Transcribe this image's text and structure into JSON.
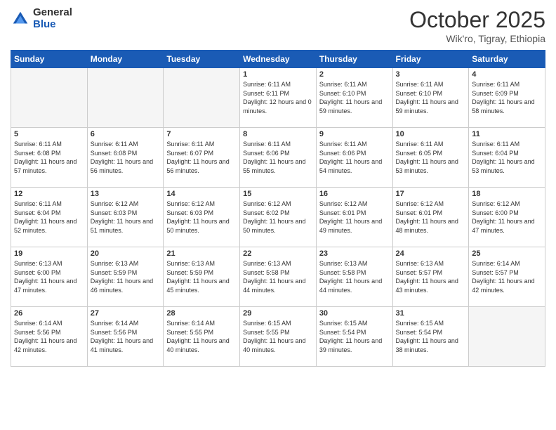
{
  "logo": {
    "general": "General",
    "blue": "Blue"
  },
  "header": {
    "title": "October 2025",
    "subtitle": "Wik'ro, Tigray, Ethiopia"
  },
  "weekdays": [
    "Sunday",
    "Monday",
    "Tuesday",
    "Wednesday",
    "Thursday",
    "Friday",
    "Saturday"
  ],
  "weeks": [
    [
      {
        "day": "",
        "info": ""
      },
      {
        "day": "",
        "info": ""
      },
      {
        "day": "",
        "info": ""
      },
      {
        "day": "1",
        "info": "Sunrise: 6:11 AM\nSunset: 6:11 PM\nDaylight: 12 hours\nand 0 minutes."
      },
      {
        "day": "2",
        "info": "Sunrise: 6:11 AM\nSunset: 6:10 PM\nDaylight: 11 hours\nand 59 minutes."
      },
      {
        "day": "3",
        "info": "Sunrise: 6:11 AM\nSunset: 6:10 PM\nDaylight: 11 hours\nand 59 minutes."
      },
      {
        "day": "4",
        "info": "Sunrise: 6:11 AM\nSunset: 6:09 PM\nDaylight: 11 hours\nand 58 minutes."
      }
    ],
    [
      {
        "day": "5",
        "info": "Sunrise: 6:11 AM\nSunset: 6:08 PM\nDaylight: 11 hours\nand 57 minutes."
      },
      {
        "day": "6",
        "info": "Sunrise: 6:11 AM\nSunset: 6:08 PM\nDaylight: 11 hours\nand 56 minutes."
      },
      {
        "day": "7",
        "info": "Sunrise: 6:11 AM\nSunset: 6:07 PM\nDaylight: 11 hours\nand 56 minutes."
      },
      {
        "day": "8",
        "info": "Sunrise: 6:11 AM\nSunset: 6:06 PM\nDaylight: 11 hours\nand 55 minutes."
      },
      {
        "day": "9",
        "info": "Sunrise: 6:11 AM\nSunset: 6:06 PM\nDaylight: 11 hours\nand 54 minutes."
      },
      {
        "day": "10",
        "info": "Sunrise: 6:11 AM\nSunset: 6:05 PM\nDaylight: 11 hours\nand 53 minutes."
      },
      {
        "day": "11",
        "info": "Sunrise: 6:11 AM\nSunset: 6:04 PM\nDaylight: 11 hours\nand 53 minutes."
      }
    ],
    [
      {
        "day": "12",
        "info": "Sunrise: 6:11 AM\nSunset: 6:04 PM\nDaylight: 11 hours\nand 52 minutes."
      },
      {
        "day": "13",
        "info": "Sunrise: 6:12 AM\nSunset: 6:03 PM\nDaylight: 11 hours\nand 51 minutes."
      },
      {
        "day": "14",
        "info": "Sunrise: 6:12 AM\nSunset: 6:03 PM\nDaylight: 11 hours\nand 50 minutes."
      },
      {
        "day": "15",
        "info": "Sunrise: 6:12 AM\nSunset: 6:02 PM\nDaylight: 11 hours\nand 50 minutes."
      },
      {
        "day": "16",
        "info": "Sunrise: 6:12 AM\nSunset: 6:01 PM\nDaylight: 11 hours\nand 49 minutes."
      },
      {
        "day": "17",
        "info": "Sunrise: 6:12 AM\nSunset: 6:01 PM\nDaylight: 11 hours\nand 48 minutes."
      },
      {
        "day": "18",
        "info": "Sunrise: 6:12 AM\nSunset: 6:00 PM\nDaylight: 11 hours\nand 47 minutes."
      }
    ],
    [
      {
        "day": "19",
        "info": "Sunrise: 6:13 AM\nSunset: 6:00 PM\nDaylight: 11 hours\nand 47 minutes."
      },
      {
        "day": "20",
        "info": "Sunrise: 6:13 AM\nSunset: 5:59 PM\nDaylight: 11 hours\nand 46 minutes."
      },
      {
        "day": "21",
        "info": "Sunrise: 6:13 AM\nSunset: 5:59 PM\nDaylight: 11 hours\nand 45 minutes."
      },
      {
        "day": "22",
        "info": "Sunrise: 6:13 AM\nSunset: 5:58 PM\nDaylight: 11 hours\nand 44 minutes."
      },
      {
        "day": "23",
        "info": "Sunrise: 6:13 AM\nSunset: 5:58 PM\nDaylight: 11 hours\nand 44 minutes."
      },
      {
        "day": "24",
        "info": "Sunrise: 6:13 AM\nSunset: 5:57 PM\nDaylight: 11 hours\nand 43 minutes."
      },
      {
        "day": "25",
        "info": "Sunrise: 6:14 AM\nSunset: 5:57 PM\nDaylight: 11 hours\nand 42 minutes."
      }
    ],
    [
      {
        "day": "26",
        "info": "Sunrise: 6:14 AM\nSunset: 5:56 PM\nDaylight: 11 hours\nand 42 minutes."
      },
      {
        "day": "27",
        "info": "Sunrise: 6:14 AM\nSunset: 5:56 PM\nDaylight: 11 hours\nand 41 minutes."
      },
      {
        "day": "28",
        "info": "Sunrise: 6:14 AM\nSunset: 5:55 PM\nDaylight: 11 hours\nand 40 minutes."
      },
      {
        "day": "29",
        "info": "Sunrise: 6:15 AM\nSunset: 5:55 PM\nDaylight: 11 hours\nand 40 minutes."
      },
      {
        "day": "30",
        "info": "Sunrise: 6:15 AM\nSunset: 5:54 PM\nDaylight: 11 hours\nand 39 minutes."
      },
      {
        "day": "31",
        "info": "Sunrise: 6:15 AM\nSunset: 5:54 PM\nDaylight: 11 hours\nand 38 minutes."
      },
      {
        "day": "",
        "info": ""
      }
    ]
  ]
}
